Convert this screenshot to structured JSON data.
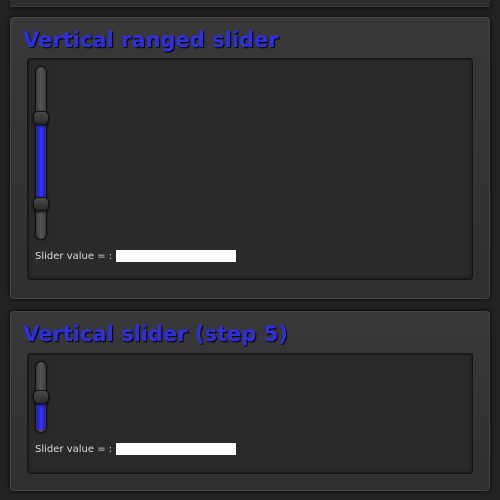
{
  "panels": [
    {
      "title": "Vertical ranged slider",
      "slider": {
        "type": "range",
        "min": 0,
        "max": 100,
        "low": 18,
        "high": 72
      },
      "value_label": "Slider value = :",
      "value": ""
    },
    {
      "title": "Vertical slider (step 5)",
      "slider": {
        "type": "single",
        "min": 0,
        "max": 100,
        "step": 5,
        "value": 50
      },
      "value_label": "Slider value = :",
      "value": ""
    }
  ],
  "colors": {
    "accent": "#2f2fe0",
    "fill": "#3535ff",
    "panel": "#333333",
    "inner": "#2a2a2a"
  }
}
